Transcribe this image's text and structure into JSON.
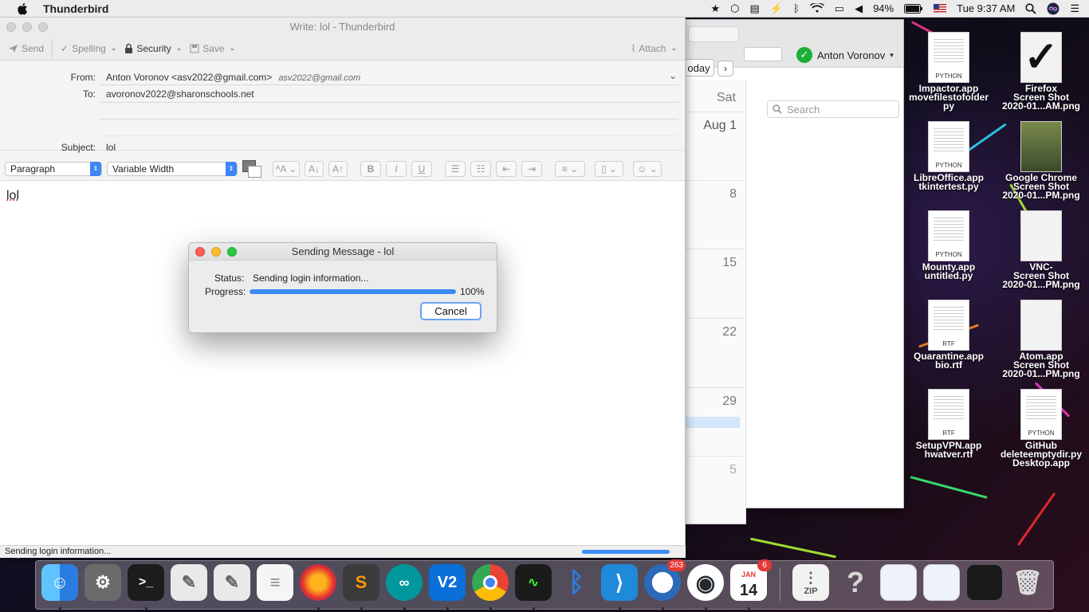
{
  "menubar": {
    "app_name": "Thunderbird",
    "battery": "94%",
    "clock": "Tue 9:37 AM"
  },
  "compose": {
    "window_title": "Write: lol - Thunderbird",
    "toolbar": {
      "send": "Send",
      "spelling": "Spelling",
      "security": "Security",
      "save": "Save",
      "attach": "Attach"
    },
    "from_label": "From:",
    "from_value": "Anton Voronov <asv2022@gmail.com>",
    "from_identity": "asv2022@gmail.com",
    "to_label": "To:",
    "to_value": "avoronov2022@sharonschools.net",
    "subject_label": "Subject:",
    "subject_value": "lol",
    "format": {
      "paragraph": "Paragraph",
      "font": "Variable Width"
    },
    "body_text": "lol",
    "status_text": "Sending login information..."
  },
  "dialog": {
    "title": "Sending Message - lol",
    "status_label": "Status:",
    "status_value": "Sending login information...",
    "progress_label": "Progress:",
    "progress_percent": "100%",
    "progress_fraction": 1.0,
    "cancel_label": "Cancel"
  },
  "calendar": {
    "account_name": "Anton Voronov",
    "today_label": "oday",
    "day_header": "Sat",
    "dates": [
      "Aug 1",
      "8",
      "15",
      "22",
      "29",
      "5"
    ],
    "search_placeholder": "Search"
  },
  "desktop_icons": [
    {
      "label1": "Impactor.app",
      "label2": "movefilestofolder",
      "label3": "py"
    },
    {
      "label1": "Firefox",
      "label2": "Screen Shot",
      "label3": "2020-01...AM.png"
    },
    {
      "label1": "LibreOffice.app",
      "label2": "tkintertest.py",
      "label3": ""
    },
    {
      "label1": "Google Chrome",
      "label2": "Screen Shot",
      "label3": "2020-01...PM.png"
    },
    {
      "label1": "Mounty.app",
      "label2": "untitled.py",
      "label3": ""
    },
    {
      "label1": "VNC-",
      "label2": "Screen Shot",
      "label3": "2020-01...PM.png"
    },
    {
      "label1": "Quarantine.app",
      "label2": "bio.rtf",
      "label3": ""
    },
    {
      "label1": "Atom.app",
      "label2": "Screen Shot",
      "label3": "2020-01...PM.png"
    },
    {
      "label1": "SetupVPN.app",
      "label2": "hwatver.rtf",
      "label3": ""
    },
    {
      "label1": "GitHub",
      "label2": "deleteemptydir.py",
      "label3": "Desktop.app"
    }
  ],
  "doc_tags": {
    "python": "PYTHON",
    "rtf": "RTF",
    "zip": "ZIP"
  },
  "dock": {
    "mail_badge": "263",
    "calendar_month": "JAN",
    "calendar_day": "14",
    "calendar_badge": "6"
  },
  "colors": {
    "accent_blue": "#3d8bf6",
    "close_red": "#fc5f57",
    "minimize_yellow": "#fdbc2e",
    "zoom_green": "#28c840",
    "check_green": "#1cae37"
  }
}
